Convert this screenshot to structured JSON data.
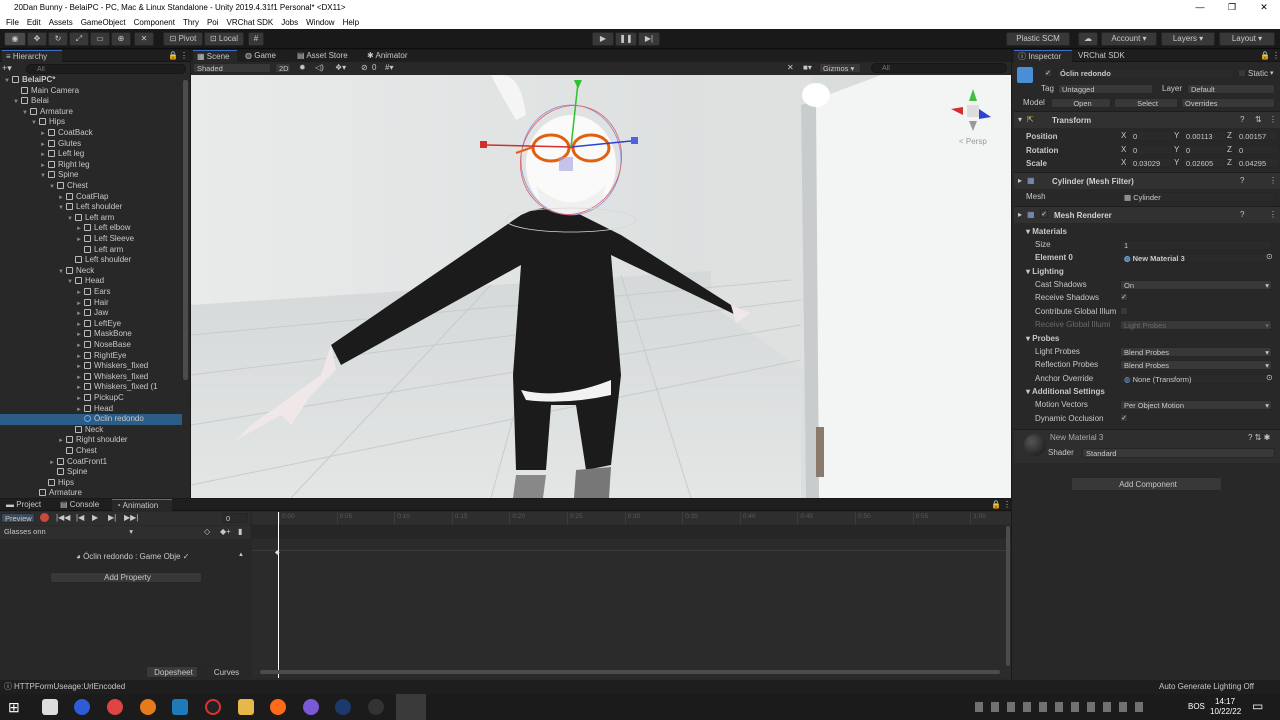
{
  "window": {
    "title": "20Dan Bunny - BelaiPC - PC, Mac & Linux Standalone - Unity 2019.4.31f1 Personal* <DX11>",
    "controls": [
      "—",
      "❐",
      "✕"
    ]
  },
  "menu": [
    "File",
    "Edit",
    "Assets",
    "GameObject",
    "Component",
    "Thry",
    "Poi",
    "VRChat SDK",
    "Jobs",
    "Window",
    "Help"
  ],
  "toolbar": {
    "pivot": "Pivot",
    "local": "Local",
    "plastic": "Plastic SCM",
    "account": "Account",
    "layers": "Layers",
    "layout": "Layout"
  },
  "hierarchy": {
    "tab": "Hierarchy",
    "search_placeholder": "All",
    "rows": [
      {
        "label": "BelaiPC*",
        "d": 0,
        "arrow": "▼",
        "bold": true
      },
      {
        "label": "Main Camera",
        "d": 1,
        "arrow": ""
      },
      {
        "label": "Belai",
        "d": 1,
        "arrow": "▼"
      },
      {
        "label": "Armature",
        "d": 2,
        "arrow": "▼"
      },
      {
        "label": "Hips",
        "d": 3,
        "arrow": "▼"
      },
      {
        "label": "CoatBack",
        "d": 4,
        "arrow": "►"
      },
      {
        "label": "Glutes",
        "d": 4,
        "arrow": "►"
      },
      {
        "label": "Left leg",
        "d": 4,
        "arrow": "►"
      },
      {
        "label": "Right leg",
        "d": 4,
        "arrow": "►"
      },
      {
        "label": "Spine",
        "d": 4,
        "arrow": "▼"
      },
      {
        "label": "Chest",
        "d": 5,
        "arrow": "▼"
      },
      {
        "label": "CoatFlap",
        "d": 6,
        "arrow": "►"
      },
      {
        "label": "Left shoulder",
        "d": 6,
        "arrow": "▼"
      },
      {
        "label": "Left arm",
        "d": 7,
        "arrow": "▼"
      },
      {
        "label": "Left elbow",
        "d": 8,
        "arrow": "►"
      },
      {
        "label": "Left Sleeve",
        "d": 8,
        "arrow": "►"
      },
      {
        "label": "Left arm",
        "d": 8,
        "arrow": ""
      },
      {
        "label": "Left shoulder",
        "d": 7,
        "arrow": ""
      },
      {
        "label": "Neck",
        "d": 6,
        "arrow": "▼"
      },
      {
        "label": "Head",
        "d": 7,
        "arrow": "▼"
      },
      {
        "label": "Ears",
        "d": 8,
        "arrow": "►"
      },
      {
        "label": "Hair",
        "d": 8,
        "arrow": "►"
      },
      {
        "label": "Jaw",
        "d": 8,
        "arrow": "►"
      },
      {
        "label": "LeftEye",
        "d": 8,
        "arrow": "►"
      },
      {
        "label": "MaskBone",
        "d": 8,
        "arrow": "►"
      },
      {
        "label": "NoseBase",
        "d": 8,
        "arrow": "►"
      },
      {
        "label": "RightEye",
        "d": 8,
        "arrow": "►"
      },
      {
        "label": "Whiskers_fixed",
        "d": 8,
        "arrow": "►"
      },
      {
        "label": "Whiskers_fixed",
        "d": 8,
        "arrow": "►"
      },
      {
        "label": "Whiskers_fixed (1",
        "d": 8,
        "arrow": "►"
      },
      {
        "label": "PickupC",
        "d": 8,
        "arrow": "►"
      },
      {
        "label": "Head",
        "d": 8,
        "arrow": "►"
      },
      {
        "label": "Óclin redondo",
        "d": 8,
        "arrow": "",
        "selected": true
      },
      {
        "label": "Neck",
        "d": 7,
        "arrow": ""
      },
      {
        "label": "Right shoulder",
        "d": 6,
        "arrow": "►"
      },
      {
        "label": "Chest",
        "d": 6,
        "arrow": ""
      },
      {
        "label": "CoatFront1",
        "d": 5,
        "arrow": "►"
      },
      {
        "label": "Spine",
        "d": 5,
        "arrow": ""
      },
      {
        "label": "Hips",
        "d": 4,
        "arrow": ""
      },
      {
        "label": "Armature",
        "d": 3,
        "arrow": ""
      }
    ]
  },
  "scene": {
    "tabs": [
      "Scene",
      "Game",
      "Asset Store",
      "Animator"
    ],
    "shading": "Shaded",
    "mode2d": "2D",
    "gizmos": "Gizmos",
    "search_placeholder": "All",
    "persp": "< Persp",
    "hidden_count": "0"
  },
  "inspector": {
    "tabs": [
      "Inspector",
      "VRChat SDK"
    ],
    "object_name": "Óclin redondo",
    "static": "Static",
    "tag_label": "Tag",
    "tag": "Untagged",
    "layer_label": "Layer",
    "layer": "Default",
    "model_label": "Model",
    "open": "Open",
    "select": "Select",
    "overrides": "Overrides",
    "transform": {
      "title": "Transform",
      "position": {
        "label": "Position",
        "x": "0",
        "y": "0.00113",
        "z": "0.00157"
      },
      "rotation": {
        "label": "Rotation",
        "x": "0",
        "y": "0",
        "z": "0"
      },
      "scale": {
        "label": "Scale",
        "x": "0.03029",
        "y": "0.02605",
        "z": "0.04295"
      }
    },
    "mesh_filter": {
      "title": "Cylinder (Mesh Filter)",
      "mesh_label": "Mesh",
      "mesh": "Cylinder"
    },
    "mesh_renderer": {
      "title": "Mesh Renderer",
      "materials": "Materials",
      "size_label": "Size",
      "size": "1",
      "element_label": "Element 0",
      "element": "New Material 3",
      "lighting": "Lighting",
      "cast_label": "Cast Shadows",
      "cast": "On",
      "receive_label": "Receive Shadows",
      "contrib_label": "Contribute Global Illum",
      "rgi_label": "Receive Global Illumi",
      "rgi": "Light Probes",
      "probes": "Probes",
      "lp_label": "Light Probes",
      "lp": "Blend Probes",
      "rp_label": "Reflection Probes",
      "rp": "Blend Probes",
      "anchor_label": "Anchor Override",
      "anchor": "None (Transform)",
      "additional": "Additional Settings",
      "mv_label": "Motion Vectors",
      "mv": "Per Object Motion",
      "occl_label": "Dynamic Occlusion"
    },
    "material": {
      "name": "New Material 3",
      "shader_label": "Shader",
      "shader": "Standard"
    },
    "add_component": "Add Component"
  },
  "bottom": {
    "tabs": [
      "Project",
      "Console",
      "Animation"
    ],
    "preview": "Preview",
    "frame": "0",
    "clip": "Glasses onn",
    "property": "Óclin redondo : Game Obje",
    "add_property": "Add Property",
    "dopesheet": "Dopesheet",
    "curves": "Curves",
    "ticks": [
      "0:00",
      "0:05",
      "0:10",
      "0:15",
      "0:20",
      "0:25",
      "0:30",
      "0:35",
      "0:40",
      "0:45",
      "0:50",
      "0:55",
      "1:00"
    ]
  },
  "status": {
    "left": "HTTPFormUseage:UrlEncoded",
    "right": "Auto Generate Lighting Off"
  },
  "taskbar": {
    "lang": "BOS",
    "time": "14:17",
    "date": "10/22/22"
  },
  "colors": {
    "accent": "#3d6fc3",
    "selection": "#2c5d87",
    "play_red": "#c84a3b"
  }
}
